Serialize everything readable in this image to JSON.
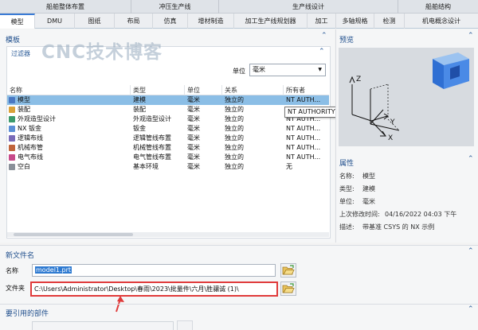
{
  "group_tabs": [
    "船舶整体布置",
    "冲压生产线",
    "生产线设计",
    "船舶结构"
  ],
  "template_tabs": [
    "模型",
    "DMU",
    "图纸",
    "布局",
    "仿真",
    "增材制造",
    "加工生产线规划器",
    "加工",
    "多轴规格",
    "检测",
    "机电概念设计"
  ],
  "active_tab": "模型",
  "watermark": "CNC技术博客",
  "template_panel": {
    "title": "模板",
    "filter_title": "过滤器",
    "unit_label": "单位",
    "unit_value": "毫米",
    "columns": [
      "名称",
      "类型",
      "单位",
      "关系",
      "所有者"
    ],
    "rows": [
      {
        "name": "模型",
        "type": "建模",
        "unit": "毫米",
        "relation": "独立的",
        "owner": "NT AUTH...",
        "selected": true,
        "icon_color": "#4a78c2"
      },
      {
        "name": "装配",
        "type": "装配",
        "unit": "毫米",
        "relation": "独立的",
        "owner": "NT AUTHORITY\\SYSTEM",
        "selected": false,
        "icon_color": "#d9a23a"
      },
      {
        "name": "外观造型设计",
        "type": "外观造型设计",
        "unit": "毫米",
        "relation": "独立的",
        "owner": "NT AUTH...",
        "selected": false,
        "icon_color": "#3b9a6c"
      },
      {
        "name": "NX 钣金",
        "type": "钣金",
        "unit": "毫米",
        "relation": "独立的",
        "owner": "NT AUTH...",
        "selected": false,
        "icon_color": "#5b8fd6"
      },
      {
        "name": "逻辑布线",
        "type": "逻辑管线布置",
        "unit": "毫米",
        "relation": "独立的",
        "owner": "NT AUTH...",
        "selected": false,
        "icon_color": "#7a6bb8"
      },
      {
        "name": "机械布管",
        "type": "机械管线布置",
        "unit": "毫米",
        "relation": "独立的",
        "owner": "NT AUTH...",
        "selected": false,
        "icon_color": "#c0643b"
      },
      {
        "name": "电气布线",
        "type": "电气管线布置",
        "unit": "毫米",
        "relation": "独立的",
        "owner": "NT AUTH...",
        "selected": false,
        "icon_color": "#c74a8a"
      },
      {
        "name": "空白",
        "type": "基本环境",
        "unit": "毫米",
        "relation": "独立的",
        "owner": "无",
        "selected": false,
        "icon_color": "#8a9099"
      }
    ],
    "tooltip": "NT AUTHORITY\\SYSTEM"
  },
  "preview": {
    "title": "预览",
    "axes": [
      "Z",
      "Y",
      "X"
    ]
  },
  "properties": {
    "title": "属性",
    "items": [
      {
        "label": "名称:",
        "value": "模型"
      },
      {
        "label": "类型:",
        "value": "建模"
      },
      {
        "label": "单位:",
        "value": "毫米"
      },
      {
        "label": "上次修改时间:",
        "value": "04/16/2022 04:03 下午"
      },
      {
        "label": "描述:",
        "value": "带基准 CSYS 的 NX 示例"
      }
    ]
  },
  "new_file": {
    "title": "新文件名",
    "name_label": "名称",
    "name_value": "model1.prt",
    "folder_label": "文件夹",
    "folder_value": "C:\\Users\\Administrator\\Desktop\\春雨\\2023\\批量件\\六月\\胜骧诚 (1)\\"
  },
  "referenced_parts": {
    "title": "要引用的部件"
  },
  "colors": {
    "accent": "#3a7bd5",
    "selection": "#8bbee6",
    "highlight": "#e03a3a"
  }
}
